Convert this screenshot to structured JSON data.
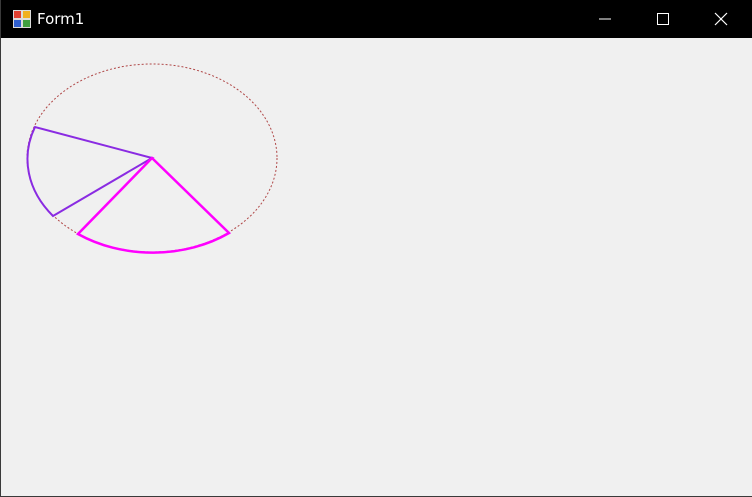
{
  "window": {
    "title": "Form1",
    "title_bar_color": "#000000",
    "client_background": "#f0f0f0"
  },
  "caption_buttons": [
    "minimize-icon",
    "maximize-icon",
    "close-icon"
  ],
  "drawing": {
    "ellipse_outline_color": "#b04848",
    "purple_pie_color": "#8a2be2",
    "magenta_pie_color": "#ff00ff"
  }
}
